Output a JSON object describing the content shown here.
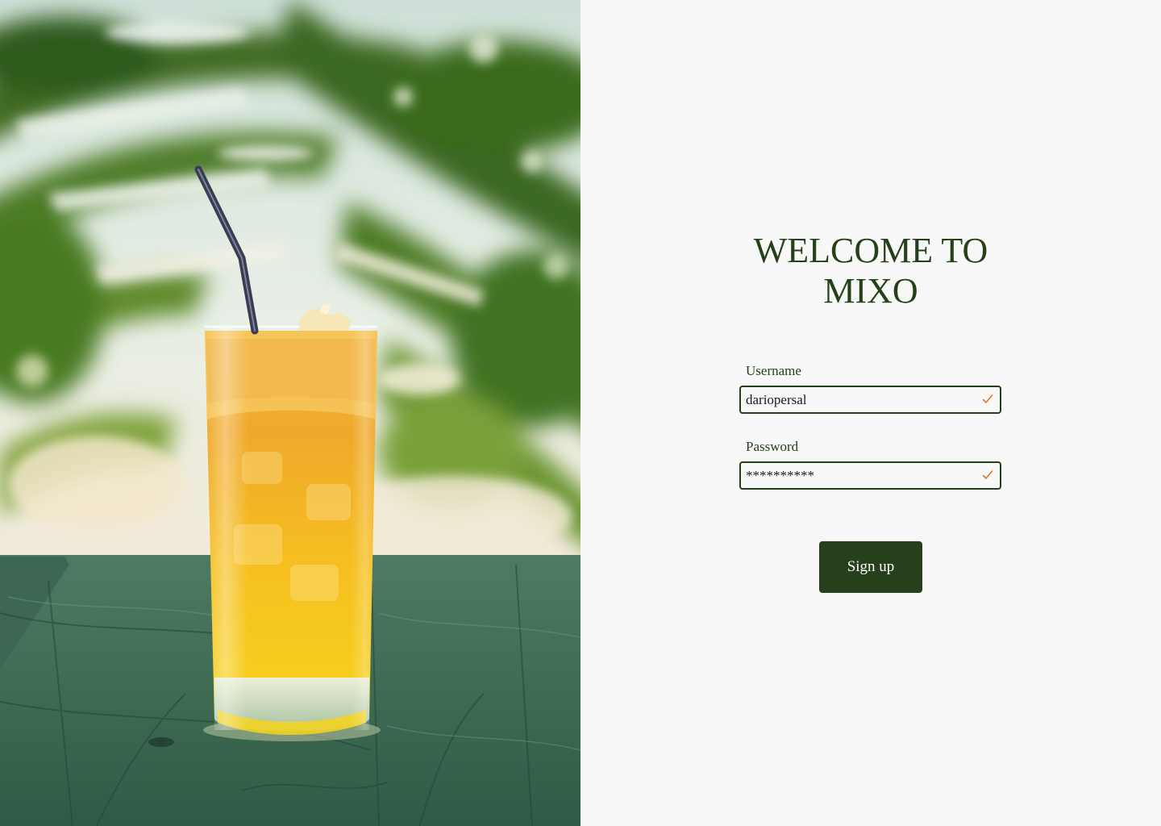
{
  "app": {
    "title_line1": "WELCOME TO",
    "title_line2": "MIXO"
  },
  "form": {
    "username": {
      "label": "Username",
      "value": "dariopersal",
      "valid_icon": "check-icon"
    },
    "password": {
      "label": "Password",
      "value": "**********",
      "valid_icon": "check-icon"
    },
    "submit_label": "Sign up"
  },
  "hero_image": {
    "description_icon": "cocktail-photo"
  },
  "colors": {
    "brand_green": "#25401a",
    "background": "#f8f8f8",
    "check_orange": "#e07a2a"
  }
}
